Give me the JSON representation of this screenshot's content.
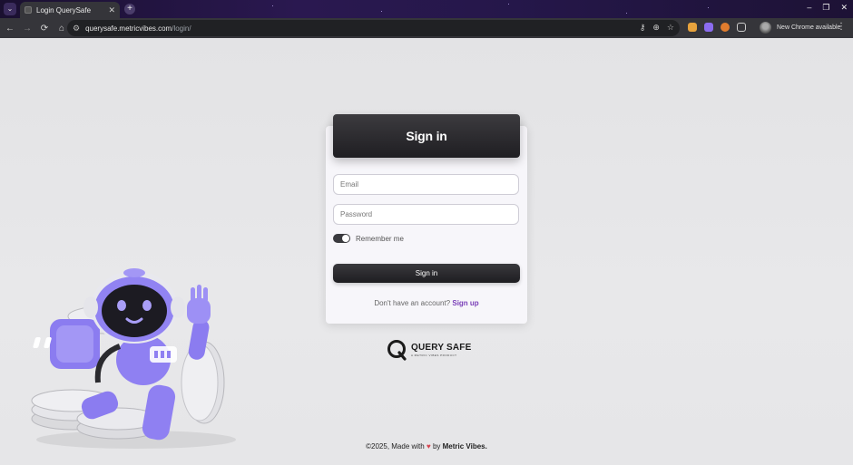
{
  "browser": {
    "tab": {
      "title": "Login QuerySafe",
      "close_glyph": "✕"
    },
    "new_tab_glyph": "+",
    "tab_search_glyph": "⌄",
    "window_controls": [
      "–",
      "❐",
      "✕"
    ],
    "nav": {
      "back": "←",
      "forward": "→",
      "reload": "⟳",
      "home": "⌂"
    },
    "url": {
      "host": "querysafe.metricvibes.com",
      "path": "/login/"
    },
    "omnibox_icons": [
      "key-icon",
      "zoom-icon",
      "bookmark-star-icon"
    ],
    "update_chip": "New Chrome available",
    "menu_glyph": "⋮"
  },
  "card": {
    "title": "Sign in",
    "email_placeholder": "Email",
    "password_placeholder": "Password",
    "remember_label": "Remember me",
    "remember_checked": true,
    "submit_label": "Sign in",
    "signup_prompt": "Don't have an account?",
    "signup_link": "Sign up"
  },
  "brand": {
    "name": "QUERY SAFE",
    "tagline": "A METRIC VIBES PRODUCT"
  },
  "footer": {
    "copyright": "©2025, Made with",
    "heart": "♥",
    "by": "by",
    "company": "Metric Vibes."
  },
  "colors": {
    "accent_link": "#7a3fb8",
    "robot_purple": "#8b7cf0",
    "header_dark": "#1f1e22"
  }
}
